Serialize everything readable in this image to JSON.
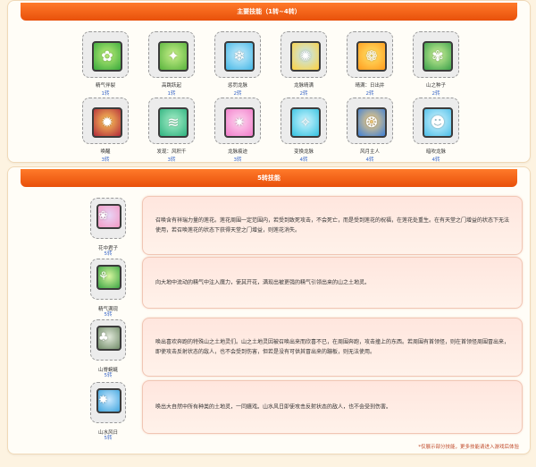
{
  "sections": {
    "main": {
      "title": "主要技能（1转~4转）"
    },
    "fifth": {
      "title": "5转技能"
    }
  },
  "main_skills": [
    {
      "name": "精气伴裂",
      "level": "1转",
      "colors": [
        "#bff07a",
        "#38a83b"
      ],
      "glyph": "✿"
    },
    {
      "name": "高跳跃起",
      "level": "1转",
      "colors": [
        "#c9f08a",
        "#57b23c"
      ],
      "glyph": "✦"
    },
    {
      "name": "惩罚龙脉",
      "level": "2转",
      "colors": [
        "#cdeffd",
        "#43b6e6"
      ],
      "glyph": "❄"
    },
    {
      "name": "龙脉晴满",
      "level": "2转",
      "colors": [
        "#bfe7ff",
        "#ffd23c"
      ],
      "glyph": "✺"
    },
    {
      "name": "晴满：日出井",
      "level": "2转",
      "colors": [
        "#ffe56a",
        "#ff9b1d"
      ],
      "glyph": "❁"
    },
    {
      "name": "山之种子",
      "level": "2转",
      "colors": [
        "#d3f49b",
        "#3aa04a"
      ],
      "glyph": "✾"
    },
    {
      "name": "唤醒",
      "level": "3转",
      "colors": [
        "#ffcc5a",
        "#b0283a"
      ],
      "glyph": "✹"
    },
    {
      "name": "发现：风积千",
      "level": "3转",
      "colors": [
        "#a9f0c9",
        "#2db17e"
      ],
      "glyph": "≋"
    },
    {
      "name": "龙脉痕迹",
      "level": "3转",
      "colors": [
        "#ffd6f0",
        "#f07bc9"
      ],
      "glyph": "✷"
    },
    {
      "name": "变换龙脉",
      "level": "4转",
      "colors": [
        "#cef6ff",
        "#33c1e0"
      ],
      "glyph": "✧"
    },
    {
      "name": "风月主人",
      "level": "4转",
      "colors": [
        "#ffd27a",
        "#3d7fd6"
      ],
      "glyph": "❂"
    },
    {
      "name": "暗吹龙脉",
      "level": "4转",
      "colors": [
        "#d7f7ff",
        "#4bbde8"
      ],
      "glyph": "☻"
    }
  ],
  "fifth_skills": [
    {
      "name": "花中君子",
      "level": "5转",
      "colors": [
        "#e8d6f7",
        "#f399c4"
      ],
      "glyph": "❀",
      "desc": "召唤含有祥瑞力量的莲花。莲花周围一定范围内，若受到致死攻击，不会死亡，而是受到莲花的祝福，在莲花处重生。在有天堂之门增益的状态下无法使用，若召唤莲花的状态下获得天堂之门增益，则莲花消失。"
    },
    {
      "name": "精气满现",
      "level": "5转",
      "colors": [
        "#d8f6a0",
        "#3aa443"
      ],
      "glyph": "⚘",
      "desc": "向大地中流动的精气中注入魔力，使其开花，满现出被更强的精气引领出来的山之土地灵。"
    },
    {
      "name": "山脊蜿蜒",
      "level": "5转",
      "colors": [
        "#e3eadc",
        "#6f8a67"
      ],
      "glyph": "♣",
      "desc": "唤出喜欢奔跑的特殊山之土地灵们。山之土地灵因被召唤出来而欣喜不已，在周围奔跑，攻击撞上的东西。若周围有首领怪，则在首领怪周围冒出来，即使攻击反射状态的敌人，也不会受到伤害，但若是没有可供其冒出来的蹦板，则无法使用。"
    },
    {
      "name": "山水风日",
      "level": "5转",
      "colors": [
        "#cbe9ff",
        "#3ea4dd"
      ],
      "glyph": "✸",
      "desc": "唤出大自然中所有种类的土地灵，一同嬉戏。山水风日即使攻击反射状态的敌人，也不会受到伤害。"
    }
  ],
  "footer_note": "*仅展示部分技能，更多技能请进入游戏后体验"
}
